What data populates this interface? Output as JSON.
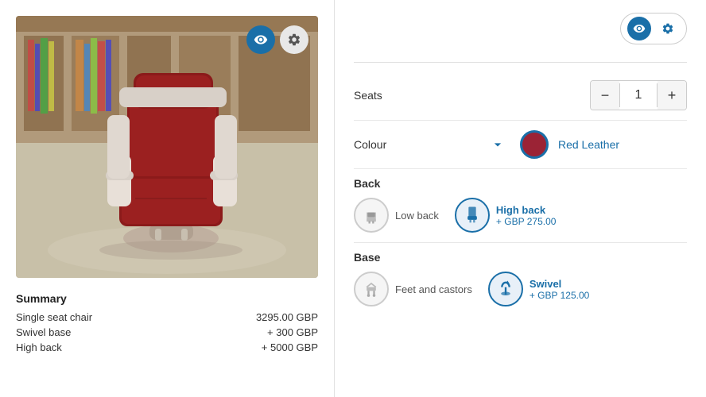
{
  "left": {
    "image_alt": "Red leather chair",
    "controls": {
      "eye_label": "👁",
      "gear_label": "⚙"
    },
    "summary": {
      "title": "Summary",
      "rows": [
        {
          "label": "Single seat chair",
          "price": "3295.00 GBP"
        },
        {
          "label": "Swivel base",
          "price": "+ 300 GBP"
        },
        {
          "label": "High back",
          "price": "+ 5000 GBP"
        }
      ]
    }
  },
  "right": {
    "header": {
      "eye_label": "👁",
      "gear_label": "⚙"
    },
    "seats": {
      "label": "Seats",
      "value": "1",
      "decrement_label": "−",
      "increment_label": "+"
    },
    "colour": {
      "label": "Colour",
      "chevron": "∨",
      "swatch_color": "#9B2335",
      "selected_name": "Red Leather"
    },
    "back": {
      "section_title": "Back",
      "options": [
        {
          "id": "low-back",
          "name": "Low back",
          "price": "",
          "selected": false,
          "icon": "🪑"
        },
        {
          "id": "high-back",
          "name": "High back",
          "price": "+ GBP 275.00",
          "selected": true,
          "icon": "🪑"
        }
      ]
    },
    "base": {
      "section_title": "Base",
      "options": [
        {
          "id": "feet-castors",
          "name": "Feet and castors",
          "price": "",
          "selected": false,
          "icon": "⊕"
        },
        {
          "id": "swivel",
          "name": "Swivel",
          "price": "+ GBP 125.00",
          "selected": true,
          "icon": "↺"
        }
      ]
    }
  }
}
